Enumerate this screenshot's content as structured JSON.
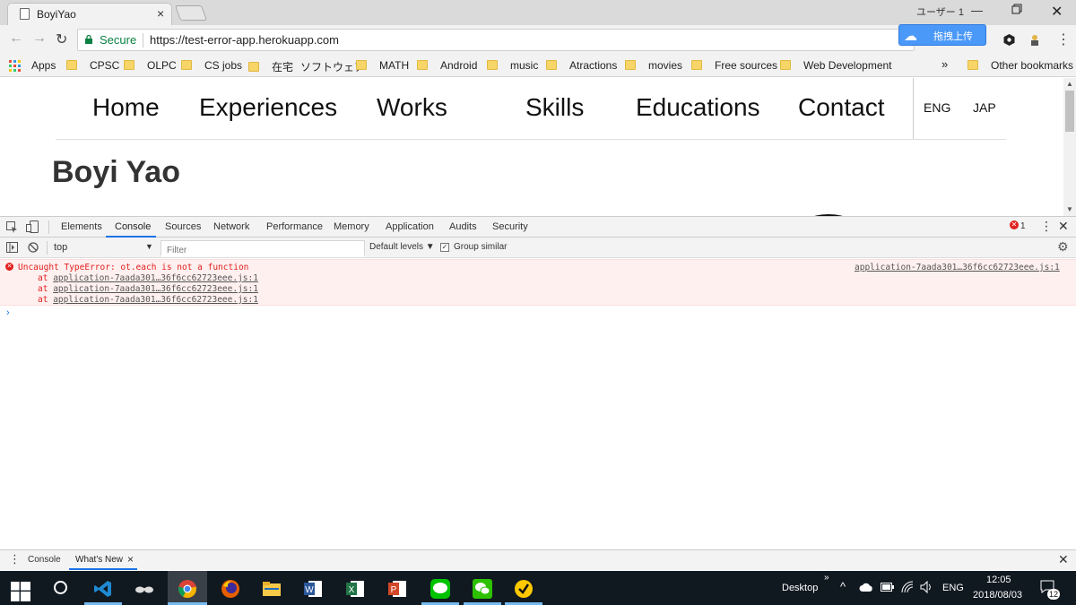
{
  "browser": {
    "tab_title": "BoyiYao",
    "tab_close": "×",
    "user_label": "ユーザー 1",
    "secure_label": "Secure",
    "url": "https://test-error-app.herokuapp.com",
    "extension_popup_text": "拖拽上传",
    "menu_icon": "⋮"
  },
  "bookmarks": {
    "apps_label": "Apps",
    "items": [
      "CPSC",
      "OLPC",
      "CS jobs",
      "在宅",
      "ソフトウェア",
      "MATH",
      "Android",
      "music",
      "Atractions",
      "movies",
      "Free sources",
      "Web Development"
    ],
    "overflow": "»",
    "other": "Other bookmarks"
  },
  "page": {
    "nav_items": [
      "Home",
      "Experiences",
      "Works",
      "Skills",
      "Educations",
      "Contact"
    ],
    "lang_options": [
      "ENG",
      "JAP"
    ],
    "heading": "Boyi Yao"
  },
  "devtools": {
    "tabs": [
      "Elements",
      "Console",
      "Sources",
      "Network",
      "Performance",
      "Memory",
      "Application",
      "Audits",
      "Security"
    ],
    "active_tab": "Console",
    "error_count": "1",
    "context": "top",
    "filter_placeholder": "Filter",
    "levels_label": "Default levels ▼",
    "group_similar_label": "Group similar",
    "error": {
      "message": "Uncaught TypeError: ot.each is not a function",
      "source": "application-7aada301…36f6cc62723eee.js:1",
      "stack_prefix": "at",
      "stack": [
        "application-7aada301…36f6cc62723eee.js:1",
        "application-7aada301…36f6cc62723eee.js:1",
        "application-7aada301…36f6cc62723eee.js:1"
      ]
    },
    "prompt": "›",
    "drawer_tabs": [
      "Console",
      "What's New"
    ],
    "drawer_close": "×"
  },
  "taskbar": {
    "desktop_label": "Desktop",
    "chevron": "»",
    "lang": "ENG",
    "time": "12:05",
    "date": "2018/08/03",
    "notification_count": "12"
  },
  "colors": {
    "secure_green": "#0b8043",
    "error_red": "#e0201c",
    "error_bg": "#fff0f0",
    "accent_blue": "#1a73e8",
    "taskbar_bg": "#101820"
  }
}
